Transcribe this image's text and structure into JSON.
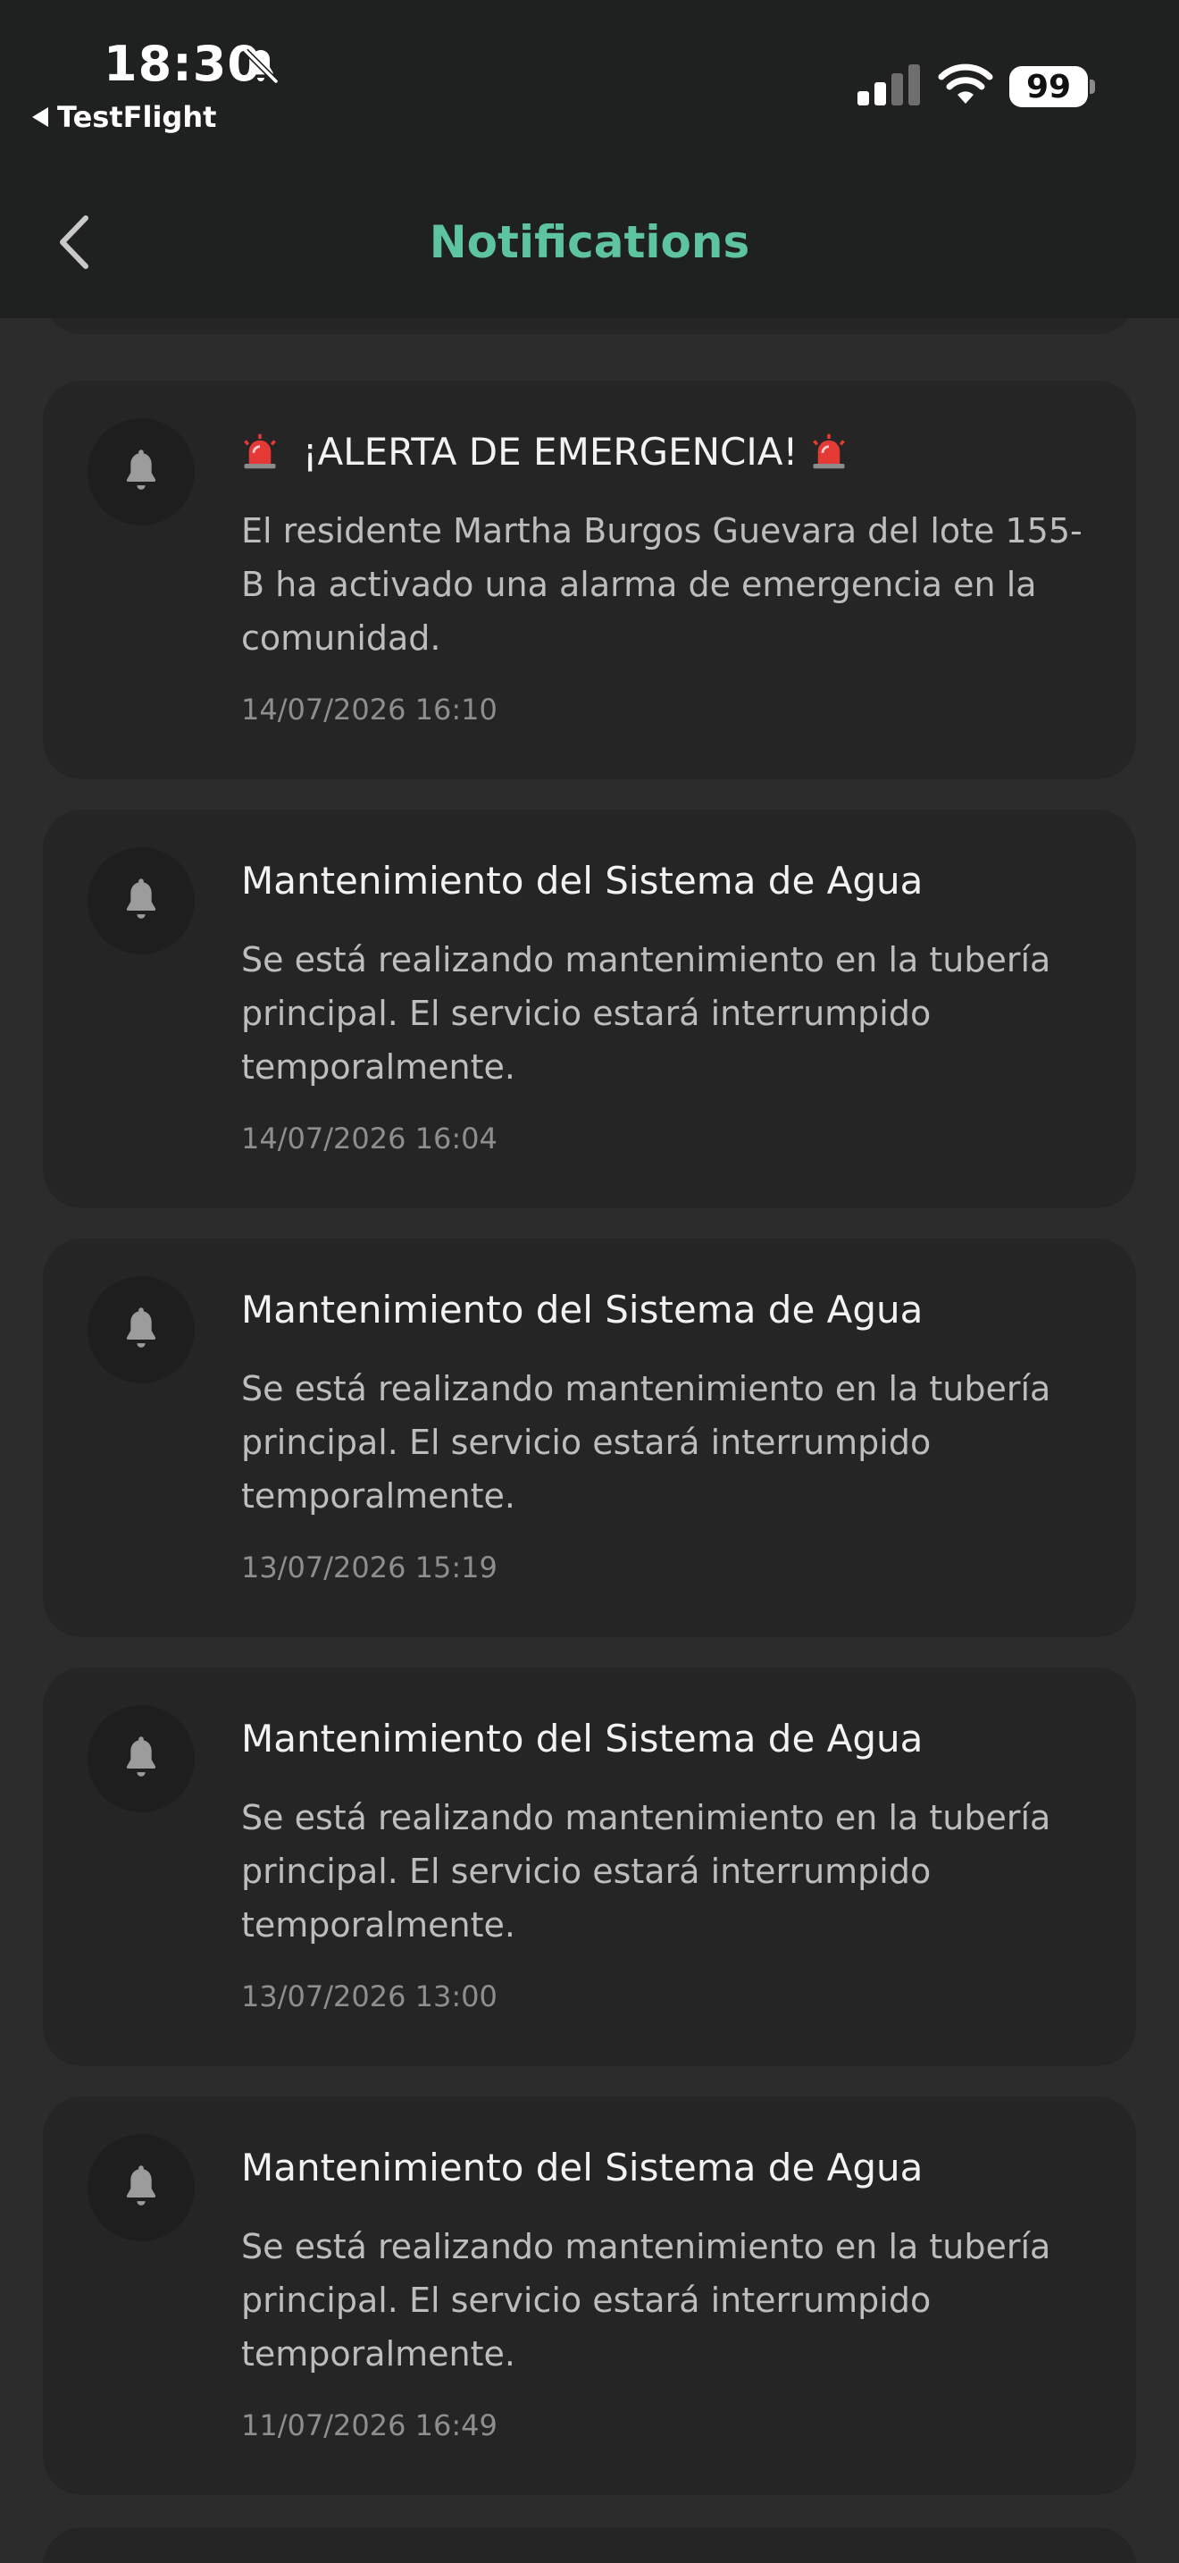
{
  "status_bar": {
    "time": "18:30",
    "back_app_label": "TestFlight",
    "battery_level": "99",
    "icons": [
      "bell-slash-icon",
      "cellular-signal-icon",
      "wifi-icon",
      "battery-icon"
    ]
  },
  "header": {
    "title": "Notifications",
    "accent_color": "#5ec4a0",
    "back_icon": "chevron-left-icon"
  },
  "notifications": [
    {
      "icon": "bell-icon",
      "emergency": true,
      "title": "¡ALERTA DE EMERGENCIA!",
      "title_decor_icon": "rotating-light-emoji",
      "body": "El residente Martha Burgos Guevara del lote 155-B ha activado una alarma de emergencia en la comunidad.",
      "date": "14/07/2026 16:10"
    },
    {
      "icon": "bell-icon",
      "emergency": false,
      "title": "Mantenimiento del Sistema de Agua",
      "body": "Se está realizando mantenimiento en la tubería principal. El servicio estará interrumpido temporalmente.",
      "date": "14/07/2026 16:04"
    },
    {
      "icon": "bell-icon",
      "emergency": false,
      "title": "Mantenimiento del Sistema de Agua",
      "body": "Se está realizando mantenimiento en la tubería principal. El servicio estará interrumpido temporalmente.",
      "date": "13/07/2026 15:19"
    },
    {
      "icon": "bell-icon",
      "emergency": false,
      "title": "Mantenimiento del Sistema de Agua",
      "body": "Se está realizando mantenimiento en la tubería principal. El servicio estará interrumpido temporalmente.",
      "date": "13/07/2026 13:00"
    },
    {
      "icon": "bell-icon",
      "emergency": false,
      "title": "Mantenimiento del Sistema de Agua",
      "body": "Se está realizando mantenimiento en la tubería principal. El servicio estará interrumpido temporalmente.",
      "date": "11/07/2026 16:49"
    }
  ]
}
